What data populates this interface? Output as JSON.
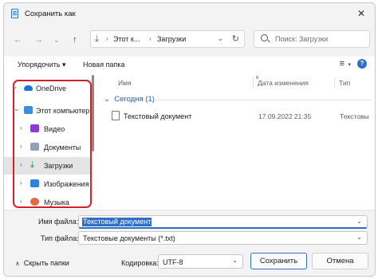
{
  "window": {
    "title": "Сохранить как",
    "close": "✕"
  },
  "nav": {
    "back": "←",
    "forward": "→",
    "recent": "⌄",
    "up": "↑",
    "address": {
      "icon": "download-icon",
      "segments": [
        "Этот к...",
        "Загрузки"
      ],
      "separator": "›",
      "chevron": "⌄",
      "refresh": "↻"
    },
    "search": {
      "placeholder": "Поиск: Загрузки"
    }
  },
  "toolbar": {
    "organize": "Упорядочить ▾",
    "new_folder": "Новая папка",
    "view_icon": "≡",
    "view_chevron": "▾",
    "help": "?"
  },
  "sidebar": {
    "items": [
      {
        "label": "OneDrive",
        "icon": "onedrive-icon",
        "chevron": "›"
      },
      {
        "label": "Этот компьютер",
        "icon": "computer-icon",
        "chevron": "⌄"
      },
      {
        "label": "Видео",
        "icon": "video-icon",
        "chevron": "›"
      },
      {
        "label": "Документы",
        "icon": "documents-icon",
        "chevron": "›"
      },
      {
        "label": "Загрузки",
        "icon": "downloads-icon",
        "chevron": "›",
        "selected": true
      },
      {
        "label": "Изображения",
        "icon": "pictures-icon",
        "chevron": "›"
      },
      {
        "label": "Музыка",
        "icon": "music-icon",
        "chevron": "›"
      }
    ],
    "highlight_color": "#d8202a"
  },
  "content": {
    "columns": [
      "Имя",
      "Дата изменения",
      "Тип"
    ],
    "sort_indicator": "∧",
    "group": {
      "label": "Сегодня (1)",
      "chevron": "⌄"
    },
    "files": [
      {
        "name": "Текстовый документ",
        "date": "17.09.2022 21:35",
        "type": "Текстовы"
      }
    ]
  },
  "form": {
    "filename_label": "Имя файла:",
    "filename_value": "Текстовый документ",
    "filetype_label": "Тип файла:",
    "filetype_value": "Текстовые документы (*.txt)",
    "hide_folders": "Скрыть папки",
    "hide_caret": "∧",
    "encoding_label": "Кодировка:",
    "encoding_value": "UTF-8",
    "save": "Сохранить",
    "cancel": "Отмена",
    "dropdown_chevron": "⌄"
  },
  "colors": {
    "accent": "#2e6fc7",
    "highlight": "#d8202a"
  }
}
